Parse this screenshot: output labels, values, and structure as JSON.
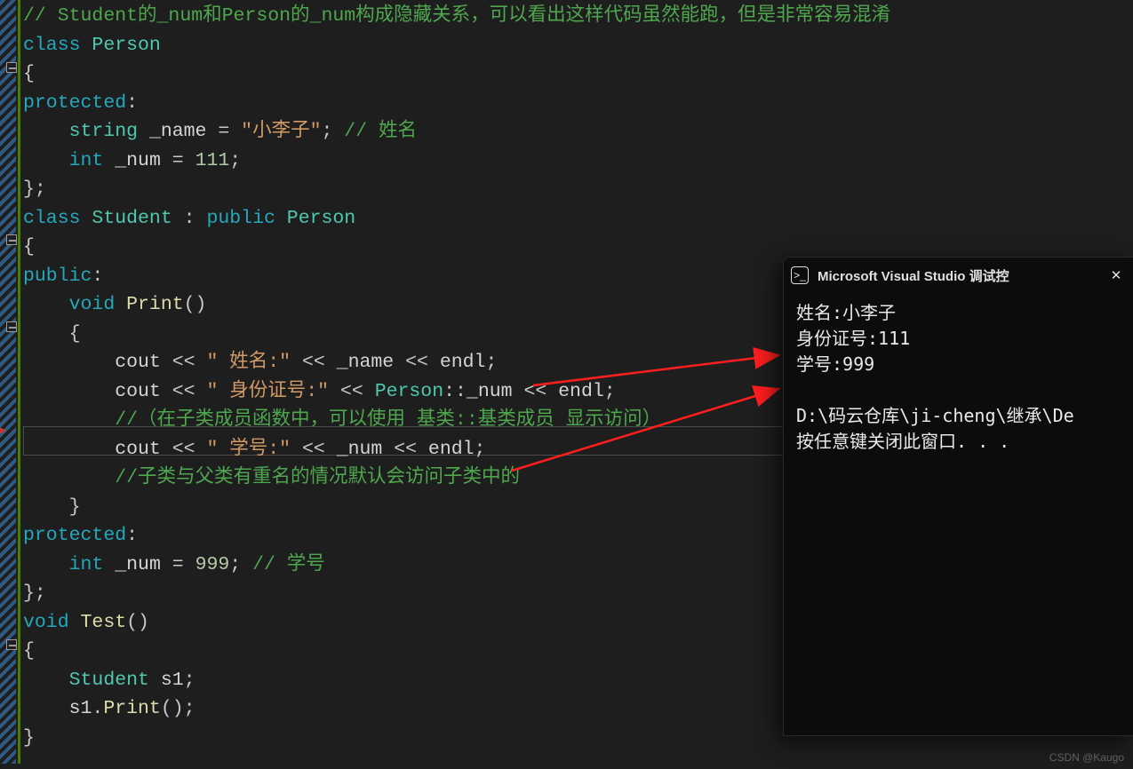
{
  "code": {
    "line1_comment": "// Student的_num和Person的_num构成隐藏关系，可以看出这样代码虽然能跑，但是非常容易混淆",
    "kw_class": "class",
    "cls_person": "Person",
    "brace_open": "{",
    "kw_protected": "protected",
    "colon": ":",
    "type_string": "string",
    "m_name": "_name",
    "eq": "=",
    "str_name": "\"小李子\"",
    "semi": ";",
    "com_name": "// 姓名",
    "type_int": "int",
    "m_num": "_num",
    "num_111": "111",
    "brace_close_semi": "};",
    "cls_student": "Student",
    "kw_public": "public",
    "kw_void": "void",
    "fn_print": "Print",
    "parens": "()",
    "id_cout": "cout",
    "op_ll": "<<",
    "str_name_lbl": "\" 姓名:\"",
    "id_endl": "endl",
    "str_id_lbl": "\" 身份证号:\"",
    "scope": "::",
    "com_explicit": "//（在子类成员函数中，可以使用 基类::基类成员 显示访问）",
    "str_sno_lbl": "\" 学号:\"",
    "com_default": "//子类与父类有重名的情况默认会访问子类中的",
    "brace_close": "}",
    "num_999": "999",
    "com_sno": "// 学号",
    "fn_test": "Test",
    "id_s1": "s1",
    "dot": "."
  },
  "console": {
    "title": "Microsoft Visual Studio 调试控",
    "out_name": "姓名:小李子",
    "out_id": "身份证号:111",
    "out_sno": "学号:999",
    "out_blank": "",
    "out_path": "D:\\码云仓库\\ji-cheng\\继承\\De",
    "out_pause": "按任意键关闭此窗口. . ."
  },
  "watermark": "CSDN @Kaugo"
}
